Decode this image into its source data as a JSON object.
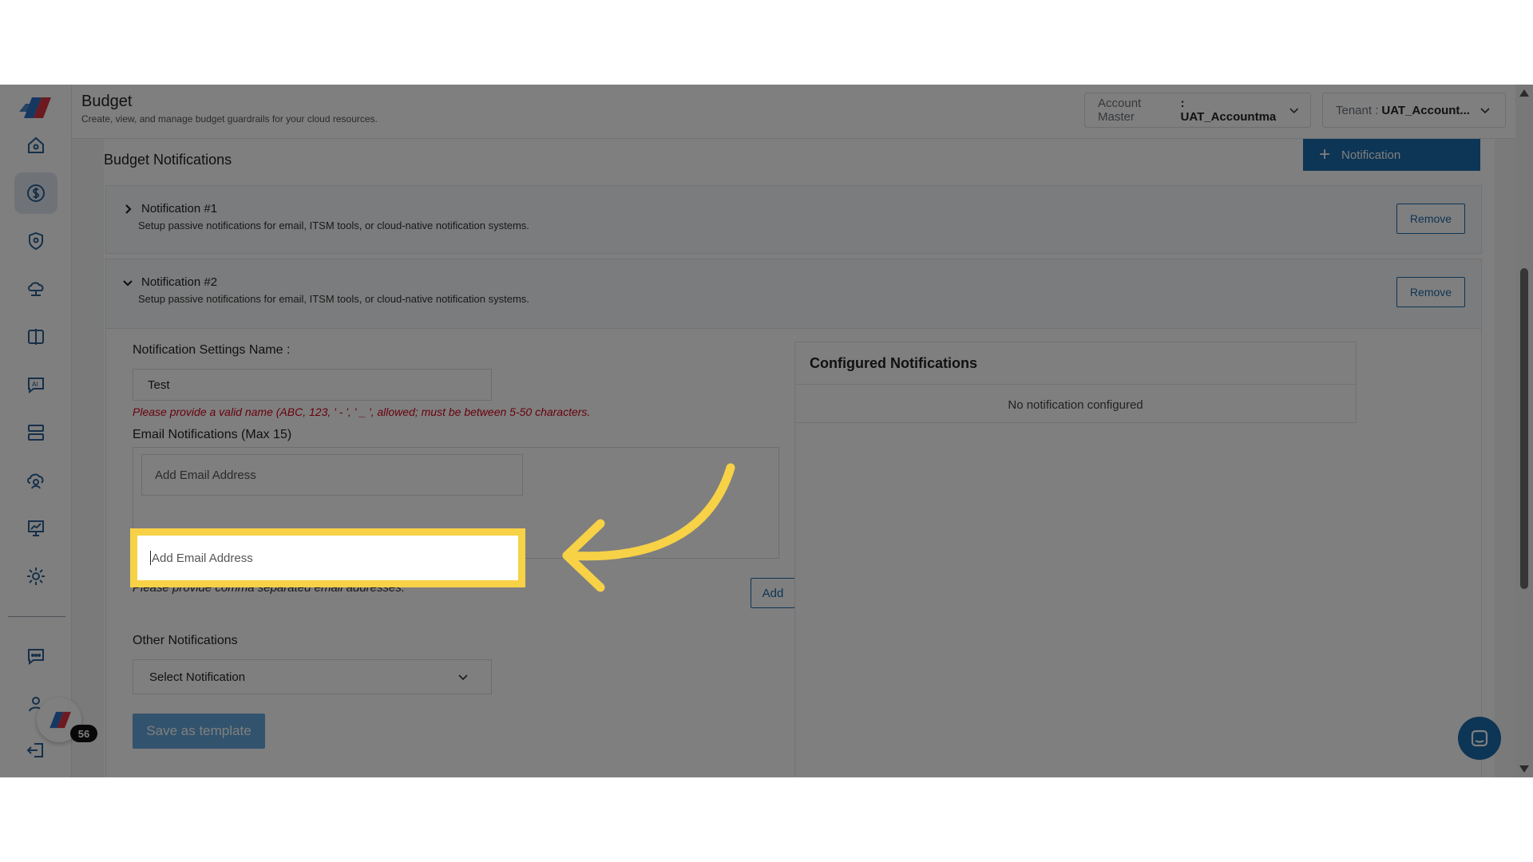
{
  "header": {
    "title": "Budget",
    "subtitle": "Create, view, and manage budget guardrails for your cloud resources.",
    "account_master": {
      "label": "Account Master",
      "value": ": UAT_Accountma"
    },
    "tenant": {
      "label": "Tenant :",
      "value": "UAT_Account..."
    }
  },
  "sidebar": {
    "items": [
      {
        "icon": "home-icon"
      },
      {
        "icon": "dollar-icon",
        "active": true
      },
      {
        "icon": "shield-location-icon"
      },
      {
        "icon": "cloud-network-icon"
      },
      {
        "icon": "compare-icon"
      },
      {
        "icon": "ai-chat-icon"
      },
      {
        "icon": "server-icon"
      },
      {
        "icon": "cloud-user-icon"
      },
      {
        "icon": "presentation-icon"
      },
      {
        "icon": "gear-icon"
      },
      {
        "icon": "chat-settings-icon"
      },
      {
        "icon": "user-settings-icon"
      },
      {
        "icon": "logout-icon"
      }
    ],
    "chat_count": "56"
  },
  "budget_notifications": {
    "title": "Budget Notifications",
    "add_button": "Notification",
    "notifications": [
      {
        "title": "Notification #1",
        "description": "Setup passive notifications for email, ITSM tools, or cloud-native notification systems.",
        "expanded": false,
        "remove_label": "Remove"
      },
      {
        "title": "Notification #2",
        "description": "Setup passive notifications for email, ITSM tools, or cloud-native notification systems.",
        "expanded": true,
        "remove_label": "Remove"
      }
    ]
  },
  "form": {
    "name_label": "Notification Settings Name :",
    "name_value": "Test",
    "name_error": "Please provide a valid name (ABC, 123, ' - ', ' _ ', allowed; must be between 5-50 characters.",
    "email_label": "Email Notifications (Max 15)",
    "email_placeholder": "Add Email Address",
    "email_hint": "Please provide comma separated email addresses.",
    "add_label": "Add",
    "other_label": "Other Notifications",
    "other_select": "Select Notification",
    "save_label": "Save as template"
  },
  "configured": {
    "title": "Configured Notifications",
    "empty": "No notification configured"
  },
  "colors": {
    "primary": "#1b6aab",
    "highlight": "#f7d146",
    "error": "#d0021b"
  }
}
